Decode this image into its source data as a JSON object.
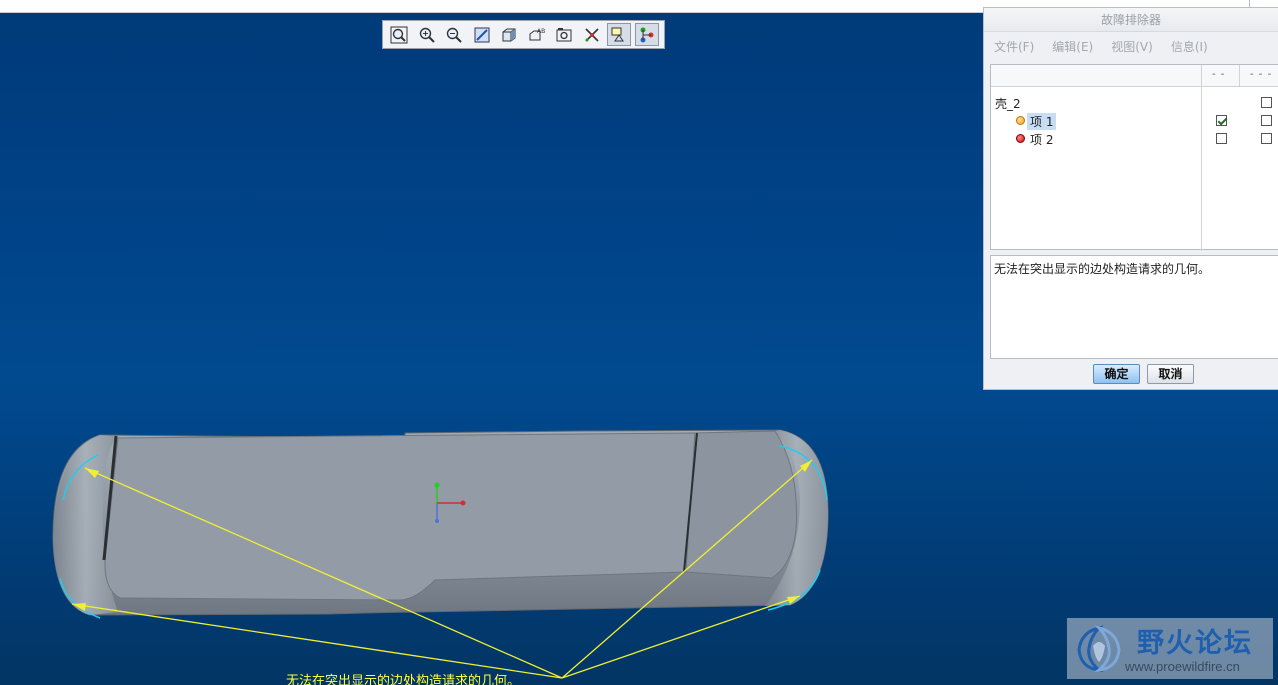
{
  "dialog": {
    "title": "故障排除器",
    "menu": [
      "文件(F)",
      "编辑(E)",
      "视图(V)",
      "信息(I)"
    ],
    "header_col1": "- -",
    "header_col2": "- - -",
    "tree": {
      "root": "壳_2",
      "items": [
        {
          "label": "项 1",
          "status_color": "#f0a020",
          "checked1": true,
          "checked2": false,
          "selected": true
        },
        {
          "label": "项 2",
          "status_color": "#c01010",
          "checked1": false,
          "checked2": false,
          "selected": false
        }
      ]
    },
    "message": "无法在突出显示的边处构造请求的几何。",
    "ok_label": "确定",
    "cancel_label": "取消"
  },
  "viewport": {
    "status_message": "无法在突出显示的边处构造请求的几何。",
    "toolbar_icons": [
      "zoom-fit-icon",
      "zoom-in-icon",
      "zoom-out-icon",
      "repaint-icon",
      "shading-icon",
      "view-manager-icon",
      "saved-views-icon",
      "datum-display-icon",
      "annotation-icon",
      "spin-center-icon"
    ],
    "colors": {
      "annotation": "#f0f030",
      "highlight_edge": "#22ccee",
      "model": "#8c959f"
    }
  },
  "watermark": {
    "brand": "野火论坛",
    "url": "www.proewildfire.cn"
  }
}
